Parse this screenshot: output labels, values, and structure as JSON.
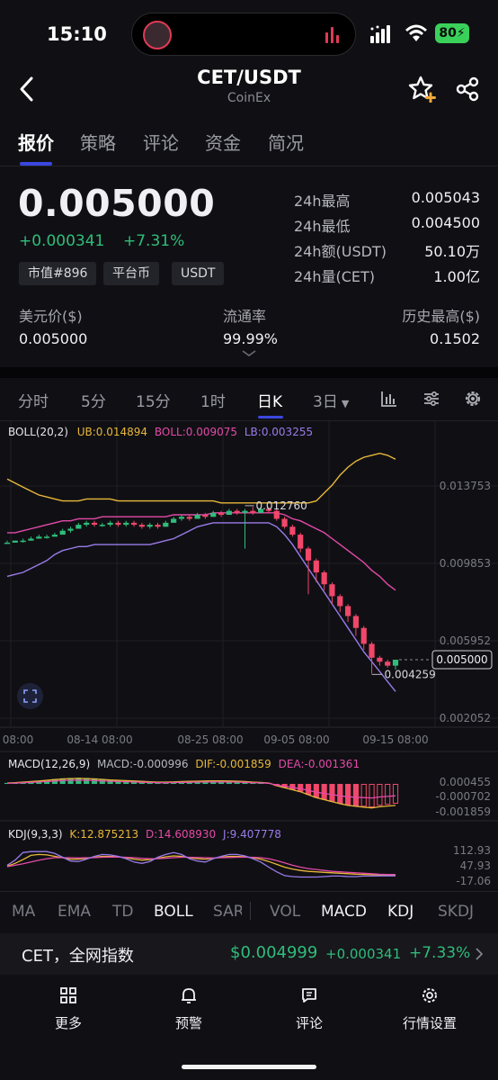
{
  "status_bar": {
    "time": "15:10",
    "battery": "80"
  },
  "header": {
    "pair": "CET/USDT",
    "exchange": "CoinEx"
  },
  "tabs": [
    "报价",
    "策略",
    "评论",
    "资金",
    "简况"
  ],
  "ticker": {
    "last_price": "0.005000",
    "change": "+0.000341",
    "change_pct": "+7.31%",
    "tags": [
      "市值#896",
      "平台币",
      "USDT"
    ],
    "stats": [
      {
        "label": "24h最高",
        "value": "0.005043"
      },
      {
        "label": "24h最低",
        "value": "0.004500"
      },
      {
        "label": "24h额(USDT)",
        "value": "50.10万"
      },
      {
        "label": "24h量(CET)",
        "value": "1.00亿"
      }
    ],
    "usd_price_label": "美元价($)",
    "usd_price": "0.005000",
    "circulation_label": "流通率",
    "circulation": "99.99%",
    "ath_label": "历史最高($)",
    "ath": "0.1502"
  },
  "timeframes": [
    "分时",
    "5分",
    "15分",
    "1时",
    "日K",
    "3日"
  ],
  "active_timeframe": "日K",
  "chart": {
    "boll_header": {
      "name": "BOLL(20,2)",
      "ub": "UB:0.014894",
      "mid": "BOLL:0.009075",
      "lb": "LB:0.003255"
    },
    "price_axis": [
      "0.013753",
      "0.009853",
      "0.005952",
      "0.002052"
    ],
    "high_marker": "0.012760",
    "low_marker": "0.004259",
    "current_price_tag": "0.005000",
    "date_axis": [
      "08:00",
      "08-14 08:00",
      "08-25 08:00",
      "09-05 08:00",
      "09-15 08:00"
    ],
    "macd_header": {
      "name": "MACD(12,26,9)",
      "macd": "MACD:-0.000996",
      "dif": "DIF:-0.001859",
      "dea": "DEA:-0.001361"
    },
    "macd_axis": [
      "0.000455",
      "-0.000702",
      "-0.001859"
    ],
    "kdj_header": {
      "name": "KDJ(9,3,3)",
      "k": "K:12.875213",
      "d": "D:14.608930",
      "j": "J:9.407778"
    },
    "kdj_axis": [
      "112.93",
      "47.93",
      "-17.06"
    ]
  },
  "indicator_tabs": [
    "MA",
    "EMA",
    "TD",
    "BOLL",
    "SAR",
    "VOL",
    "MACD",
    "KDJ",
    "SKDJ"
  ],
  "index_strip": {
    "name": "CET，全网指数",
    "price": "$0.004999",
    "change": "+0.000341",
    "pct": "+7.33%"
  },
  "bottom_nav": [
    "更多",
    "预警",
    "评论",
    "行情设置"
  ],
  "colors": {
    "up": "#2fbd7a",
    "down": "#f0476a",
    "accent": "#3b47e0",
    "boll_ub": "#e8b73a",
    "boll_mid": "#e44aa8",
    "boll_lb": "#9a7bea"
  },
  "chart_data": {
    "type": "candlestick",
    "ylim": [
      0.002052,
      0.013753
    ],
    "x": [
      "08:00",
      "08-14 08:00",
      "08-25 08:00",
      "09-05 08:00",
      "09-15 08:00"
    ],
    "series": [
      {
        "name": "UB",
        "values": [
          0.0141,
          0.0139,
          0.0137,
          0.0135,
          0.0133,
          0.0132,
          0.0131,
          0.013,
          0.013,
          0.013,
          0.0131,
          0.0131,
          0.0131,
          0.0131,
          0.013,
          0.013,
          0.013,
          0.013,
          0.013,
          0.013,
          0.013,
          0.013,
          0.013,
          0.013,
          0.013,
          0.013,
          0.013,
          0.0129,
          0.0129,
          0.0129,
          0.0129,
          0.0129,
          0.0129,
          0.0129,
          0.0129,
          0.0129,
          0.0129,
          0.0129,
          0.0129,
          0.013,
          0.0134,
          0.0138,
          0.0143,
          0.0147,
          0.015,
          0.0152,
          0.0153,
          0.0154,
          0.0153,
          0.0151
        ]
      },
      {
        "name": "BOLL",
        "values": [
          0.0114,
          0.0114,
          0.0115,
          0.0116,
          0.0117,
          0.0118,
          0.0119,
          0.012,
          0.012,
          0.0121,
          0.0121,
          0.0121,
          0.0122,
          0.0122,
          0.0122,
          0.0122,
          0.0122,
          0.0122,
          0.0122,
          0.0122,
          0.0122,
          0.0123,
          0.0123,
          0.0123,
          0.0123,
          0.0123,
          0.0124,
          0.0124,
          0.0124,
          0.0124,
          0.0124,
          0.0124,
          0.0124,
          0.0124,
          0.0124,
          0.0123,
          0.0121,
          0.012,
          0.0118,
          0.0116,
          0.0114,
          0.0111,
          0.0108,
          0.0105,
          0.0102,
          0.0099,
          0.0095,
          0.0092,
          0.0088,
          0.0085
        ]
      },
      {
        "name": "LB",
        "values": [
          0.0092,
          0.0093,
          0.0094,
          0.0096,
          0.0098,
          0.01,
          0.0103,
          0.0105,
          0.0106,
          0.0107,
          0.0107,
          0.0108,
          0.0108,
          0.0108,
          0.0108,
          0.0108,
          0.0108,
          0.0108,
          0.0108,
          0.0109,
          0.011,
          0.0111,
          0.0113,
          0.0115,
          0.0117,
          0.0118,
          0.0119,
          0.0119,
          0.0119,
          0.0119,
          0.0119,
          0.0119,
          0.0119,
          0.0119,
          0.0117,
          0.0113,
          0.0108,
          0.0102,
          0.0096,
          0.009,
          0.0084,
          0.0078,
          0.0072,
          0.0066,
          0.006,
          0.0054,
          0.0049,
          0.0044,
          0.0039,
          0.0034
        ]
      }
    ],
    "candles": [
      [
        0.0109,
        0.0109,
        0.011,
        0.0109
      ],
      [
        0.0109,
        0.011,
        0.011,
        0.0109
      ],
      [
        0.011,
        0.011,
        0.0111,
        0.0109
      ],
      [
        0.011,
        0.0111,
        0.0112,
        0.011
      ],
      [
        0.0111,
        0.0112,
        0.0113,
        0.0111
      ],
      [
        0.0112,
        0.0112,
        0.0113,
        0.0111
      ],
      [
        0.0112,
        0.0113,
        0.0114,
        0.0112
      ],
      [
        0.0113,
        0.0115,
        0.0116,
        0.0113
      ],
      [
        0.0115,
        0.0116,
        0.0117,
        0.0114
      ],
      [
        0.0116,
        0.0118,
        0.0119,
        0.0116
      ],
      [
        0.0118,
        0.0119,
        0.012,
        0.0117
      ],
      [
        0.0119,
        0.0118,
        0.012,
        0.0117
      ],
      [
        0.0118,
        0.0118,
        0.0119,
        0.0117
      ],
      [
        0.0118,
        0.0119,
        0.012,
        0.0117
      ],
      [
        0.0119,
        0.0118,
        0.012,
        0.0117
      ],
      [
        0.0118,
        0.0119,
        0.012,
        0.0117
      ],
      [
        0.0119,
        0.0118,
        0.012,
        0.0117
      ],
      [
        0.0118,
        0.0117,
        0.0119,
        0.0116
      ],
      [
        0.0117,
        0.0118,
        0.0119,
        0.0116
      ],
      [
        0.0118,
        0.0117,
        0.0119,
        0.0116
      ],
      [
        0.0117,
        0.0119,
        0.012,
        0.0117
      ],
      [
        0.0119,
        0.0121,
        0.0122,
        0.0119
      ],
      [
        0.0121,
        0.0122,
        0.0123,
        0.012
      ],
      [
        0.0122,
        0.0121,
        0.0123,
        0.012
      ],
      [
        0.0121,
        0.0123,
        0.0124,
        0.0121
      ],
      [
        0.0123,
        0.0122,
        0.0124,
        0.0121
      ],
      [
        0.0122,
        0.0124,
        0.0125,
        0.0122
      ],
      [
        0.0124,
        0.0123,
        0.0125,
        0.0122
      ],
      [
        0.0123,
        0.0125,
        0.0126,
        0.0123
      ],
      [
        0.0125,
        0.0124,
        0.0126,
        0.0123
      ],
      [
        0.0124,
        0.0125,
        0.0126,
        0.0106
      ],
      [
        0.0125,
        0.0124,
        0.0127,
        0.0123
      ],
      [
        0.0124,
        0.0126,
        0.0127,
        0.0124
      ],
      [
        0.0126,
        0.0125,
        0.0127,
        0.0124
      ],
      [
        0.0125,
        0.0121,
        0.0126,
        0.012
      ],
      [
        0.0121,
        0.0117,
        0.0122,
        0.0116
      ],
      [
        0.0117,
        0.0113,
        0.0118,
        0.0112
      ],
      [
        0.0113,
        0.0106,
        0.0114,
        0.0104
      ],
      [
        0.0106,
        0.01,
        0.0107,
        0.0083
      ],
      [
        0.01,
        0.0094,
        0.0101,
        0.0089
      ],
      [
        0.0094,
        0.0088,
        0.0095,
        0.0085
      ],
      [
        0.0088,
        0.0082,
        0.0089,
        0.0078
      ],
      [
        0.0082,
        0.0077,
        0.0083,
        0.0074
      ],
      [
        0.0077,
        0.0072,
        0.0078,
        0.0069
      ],
      [
        0.0072,
        0.0066,
        0.0073,
        0.0062
      ],
      [
        0.0066,
        0.0058,
        0.0067,
        0.0055
      ],
      [
        0.0058,
        0.0051,
        0.0059,
        0.0043
      ],
      [
        0.0051,
        0.0049,
        0.0052,
        0.0047
      ],
      [
        0.0049,
        0.0047,
        0.005,
        0.0046
      ],
      [
        0.0047,
        0.005,
        0.005,
        0.0045
      ]
    ],
    "macd_hist": [
      5e-05,
      7e-05,
      0.0001,
      0.00013,
      0.00016,
      0.0002,
      0.00024,
      0.00028,
      0.0003,
      0.00031,
      0.0003,
      0.00028,
      0.00025,
      0.00022,
      0.0002,
      0.00018,
      0.00016,
      0.00014,
      0.00012,
      0.0001,
      0.0001,
      0.00011,
      0.00013,
      0.00014,
      0.00015,
      0.00016,
      0.00017,
      0.00017,
      0.00016,
      0.00015,
      0.00013,
      0.0001,
      8e-05,
      5e-05,
      -0.0001,
      -0.0002,
      -0.0003,
      -0.0004,
      -0.00055,
      -0.0007,
      -0.0008,
      -0.0009,
      -0.001,
      -0.00108,
      -0.00112,
      -0.00115,
      -0.00118,
      -0.0011,
      -0.00105,
      -0.001
    ],
    "kdj": {
      "k": [
        50,
        62,
        78,
        96,
        100,
        98,
        92,
        86,
        80,
        80,
        84,
        88,
        92,
        92,
        90,
        86,
        80,
        76,
        78,
        84,
        90,
        94,
        92,
        86,
        82,
        80,
        84,
        88,
        92,
        92,
        90,
        86,
        80,
        70,
        58,
        46,
        38,
        32,
        28,
        26,
        24,
        22,
        20,
        18,
        16,
        15,
        14,
        13,
        13,
        13
      ],
      "d": [
        48,
        54,
        60,
        68,
        76,
        82,
        86,
        86,
        86,
        85,
        86,
        86,
        88,
        89,
        89,
        88,
        86,
        84,
        82,
        82,
        84,
        86,
        88,
        88,
        87,
        86,
        85,
        86,
        87,
        88,
        88,
        88,
        86,
        82,
        74,
        64,
        54,
        46,
        40,
        36,
        32,
        28,
        26,
        24,
        22,
        20,
        18,
        16,
        15,
        15
      ],
      "j": [
        54,
        76,
        108,
        112,
        112,
        112,
        104,
        88,
        72,
        70,
        80,
        92,
        100,
        98,
        92,
        82,
        68,
        62,
        70,
        88,
        100,
        108,
        100,
        82,
        72,
        68,
        82,
        92,
        100,
        100,
        94,
        82,
        68,
        46,
        26,
        10,
        6,
        4,
        4,
        4,
        6,
        8,
        8,
        6,
        6,
        8,
        8,
        9,
        9,
        9
      ]
    }
  }
}
